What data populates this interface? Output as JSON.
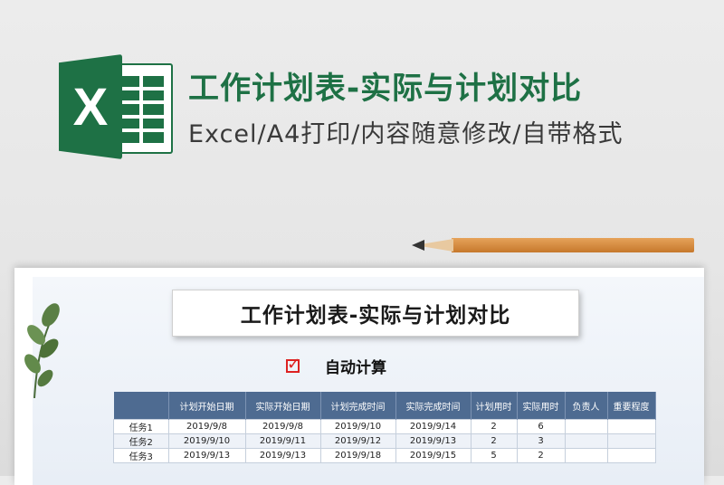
{
  "header": {
    "title": "工作计划表-实际与计划对比",
    "subtitle": "Excel/A4打印/内容随意修改/自带格式",
    "logo_letter": "X",
    "logo_icon": "excel-icon",
    "brand_color": "#1e7145"
  },
  "sheet": {
    "title": "工作计划表-实际与计划对比",
    "auto_calc_label": "自动计算",
    "checkbox_checked": true,
    "columns": [
      "",
      "计划开始日期",
      "实际开始日期",
      "计划完成时间",
      "实际完成时间",
      "计划用时",
      "实际用时",
      "负责人",
      "重要程度"
    ],
    "rows": [
      [
        "任务1",
        "2019/9/8",
        "2019/9/8",
        "2019/9/10",
        "2019/9/14",
        "2",
        "6",
        "",
        ""
      ],
      [
        "任务2",
        "2019/9/10",
        "2019/9/11",
        "2019/9/12",
        "2019/9/13",
        "2",
        "3",
        "",
        ""
      ],
      [
        "任务3",
        "2019/9/13",
        "2019/9/13",
        "2019/9/18",
        "2019/9/15",
        "5",
        "2",
        "",
        ""
      ]
    ],
    "header_color": "#4e6b91"
  }
}
